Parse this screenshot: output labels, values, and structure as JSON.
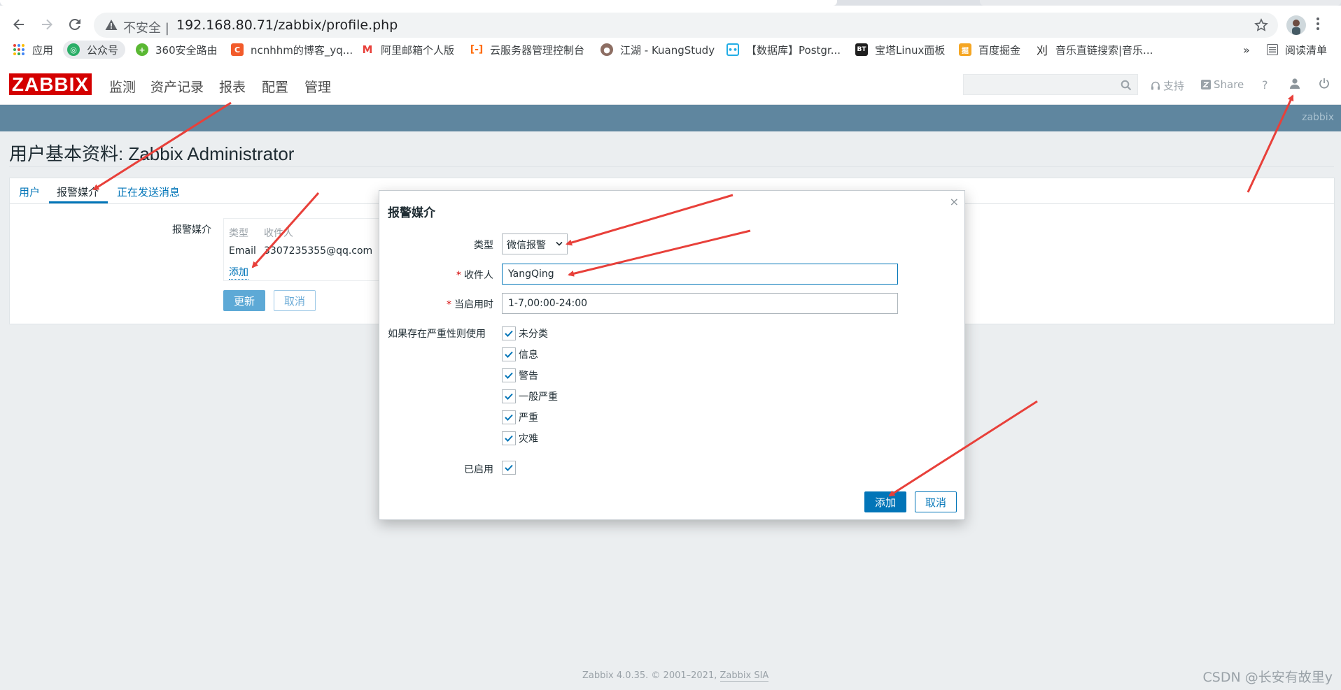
{
  "browser": {
    "address": {
      "insecure_label": "不安全 |",
      "url": "192.168.80.71/zabbix/profile.php"
    },
    "bookmarks": [
      {
        "label": "应用",
        "icon": "apps-grid-icon"
      },
      {
        "label": "公众号",
        "icon": "wechat-official-icon"
      },
      {
        "label": "360安全路由",
        "icon": "360-router-icon"
      },
      {
        "label": "ncnhhm的博客_yq...",
        "icon": "csdn-icon"
      },
      {
        "label": "阿里邮箱个人版",
        "icon": "aliyun-mail-icon"
      },
      {
        "label": "云服务器管理控制台",
        "icon": "aliyun-console-icon"
      },
      {
        "label": "江湖 - KuangStudy",
        "icon": "kuangstudy-icon"
      },
      {
        "label": "【数据库】Postgr...",
        "icon": "bilibili-icon"
      },
      {
        "label": "宝塔Linux面板",
        "icon": "bt-panel-icon"
      },
      {
        "label": "百度掘金",
        "icon": "juejin-icon"
      },
      {
        "label": "音乐直链搜索|音乐...",
        "icon": "music-icon"
      }
    ],
    "bookmarks_more": "»",
    "reading_list": "阅读清单"
  },
  "header": {
    "logo": "ZABBIX",
    "menu": [
      "监测",
      "资产记录",
      "报表",
      "配置",
      "管理"
    ],
    "support": "支持",
    "share": "Share",
    "help": "?",
    "strip_user": "zabbix"
  },
  "page": {
    "title": "用户基本资料: Zabbix Administrator",
    "tabs": [
      "用户",
      "报警媒介",
      "正在发送消息"
    ],
    "media_label": "报警媒介",
    "media_table": {
      "headers": [
        "类型",
        "收件人"
      ],
      "row": {
        "type": "Email",
        "recipient": "3307235355@qq.com"
      },
      "add_link": "添加"
    },
    "update_button": "更新",
    "cancel_button": "取消"
  },
  "dialog": {
    "title": "报警媒介",
    "close": "×",
    "type_label": "类型",
    "type_value": "微信报警",
    "recipient_label": "收件人",
    "recipient_value": "YangQing",
    "when_label": "当启用时",
    "when_value": "1-7,00:00-24:00",
    "severity_label": "如果存在严重性则使用",
    "severities": [
      {
        "label": "未分类",
        "checked": true
      },
      {
        "label": "信息",
        "checked": true
      },
      {
        "label": "警告",
        "checked": true
      },
      {
        "label": "一般严重",
        "checked": true
      },
      {
        "label": "严重",
        "checked": true
      },
      {
        "label": "灾难",
        "checked": true
      }
    ],
    "enabled_label": "已启用",
    "enabled": true,
    "add_button": "添加",
    "cancel_button": "取消"
  },
  "footer": {
    "version": "Zabbix 4.0.35. © 2001–2021, ",
    "company": "Zabbix SIA"
  },
  "watermark": "CSDN @长安有故里y",
  "colors": {
    "brand_red": "#d40000",
    "accent_blue": "#0275b8",
    "strip": "#5f869f",
    "annotation_arrow": "#e8403a"
  }
}
